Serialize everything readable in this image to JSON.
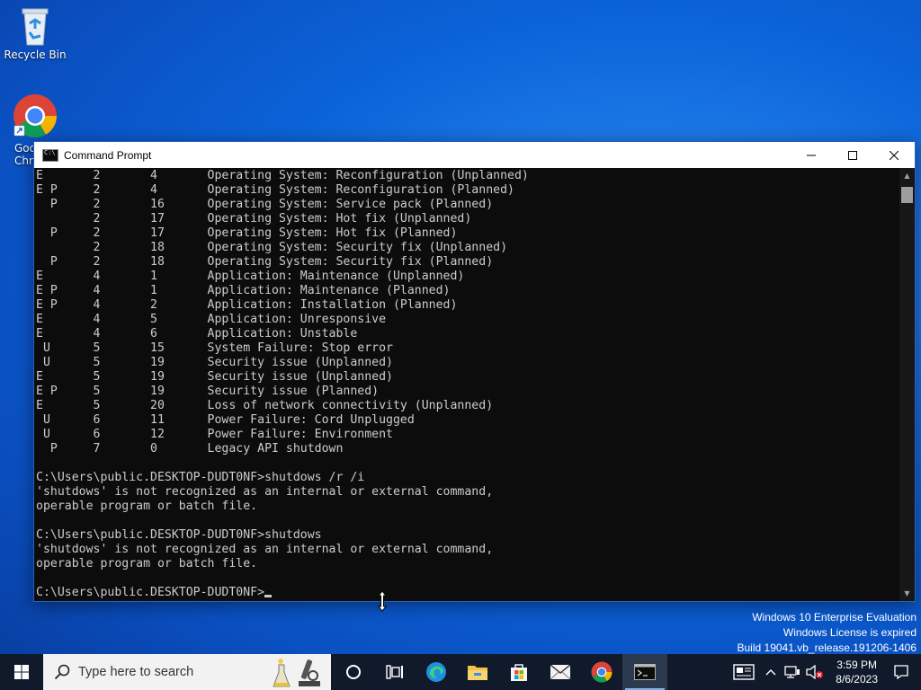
{
  "desktop": {
    "icons": [
      {
        "label": "Recycle Bin",
        "icon": "recycle-bin-icon"
      },
      {
        "label": "Goo\nChro",
        "icon": "chrome-icon"
      }
    ]
  },
  "window": {
    "title": "Command Prompt",
    "icon": "cmd-icon",
    "controls": {
      "minimize": "—",
      "maximize": "☐",
      "close": "✕"
    }
  },
  "console": {
    "lines": [
      "E       2       4       Operating System: Reconfiguration (Unplanned)",
      "E P     2       4       Operating System: Reconfiguration (Planned)",
      "  P     2       16      Operating System: Service pack (Planned)",
      "        2       17      Operating System: Hot fix (Unplanned)",
      "  P     2       17      Operating System: Hot fix (Planned)",
      "        2       18      Operating System: Security fix (Unplanned)",
      "  P     2       18      Operating System: Security fix (Planned)",
      "E       4       1       Application: Maintenance (Unplanned)",
      "E P     4       1       Application: Maintenance (Planned)",
      "E P     4       2       Application: Installation (Planned)",
      "E       4       5       Application: Unresponsive",
      "E       4       6       Application: Unstable",
      " U      5       15      System Failure: Stop error",
      " U      5       19      Security issue (Unplanned)",
      "E       5       19      Security issue (Unplanned)",
      "E P     5       19      Security issue (Planned)",
      "E       5       20      Loss of network connectivity (Unplanned)",
      " U      6       11      Power Failure: Cord Unplugged",
      " U      6       12      Power Failure: Environment",
      "  P     7       0       Legacy API shutdown",
      "",
      "C:\\Users\\public.DESKTOP-DUDT0NF>shutdows /r /i",
      "'shutdows' is not recognized as an internal or external command,",
      "operable program or batch file.",
      "",
      "C:\\Users\\public.DESKTOP-DUDT0NF>shutdows",
      "'shutdows' is not recognized as an internal or external command,",
      "operable program or batch file.",
      ""
    ],
    "prompt": "C:\\Users\\public.DESKTOP-DUDT0NF>"
  },
  "watermark": {
    "line1": "Windows 10 Enterprise Evaluation",
    "line2": "Windows License is expired",
    "line3": "Build 19041.vb_release.191206-1406"
  },
  "taskbar": {
    "search_placeholder": "Type here to search",
    "apps": [
      {
        "name": "task-view",
        "icon": "task-view-icon"
      },
      {
        "name": "edge",
        "icon": "edge-icon"
      },
      {
        "name": "file-explorer",
        "icon": "folder-icon"
      },
      {
        "name": "store",
        "icon": "store-icon"
      },
      {
        "name": "mail",
        "icon": "mail-icon"
      },
      {
        "name": "chrome",
        "icon": "chrome-icon"
      },
      {
        "name": "command-prompt",
        "icon": "cmd-icon",
        "active": true
      }
    ],
    "clock": {
      "time": "3:59 PM",
      "date": "8/6/2023"
    }
  }
}
